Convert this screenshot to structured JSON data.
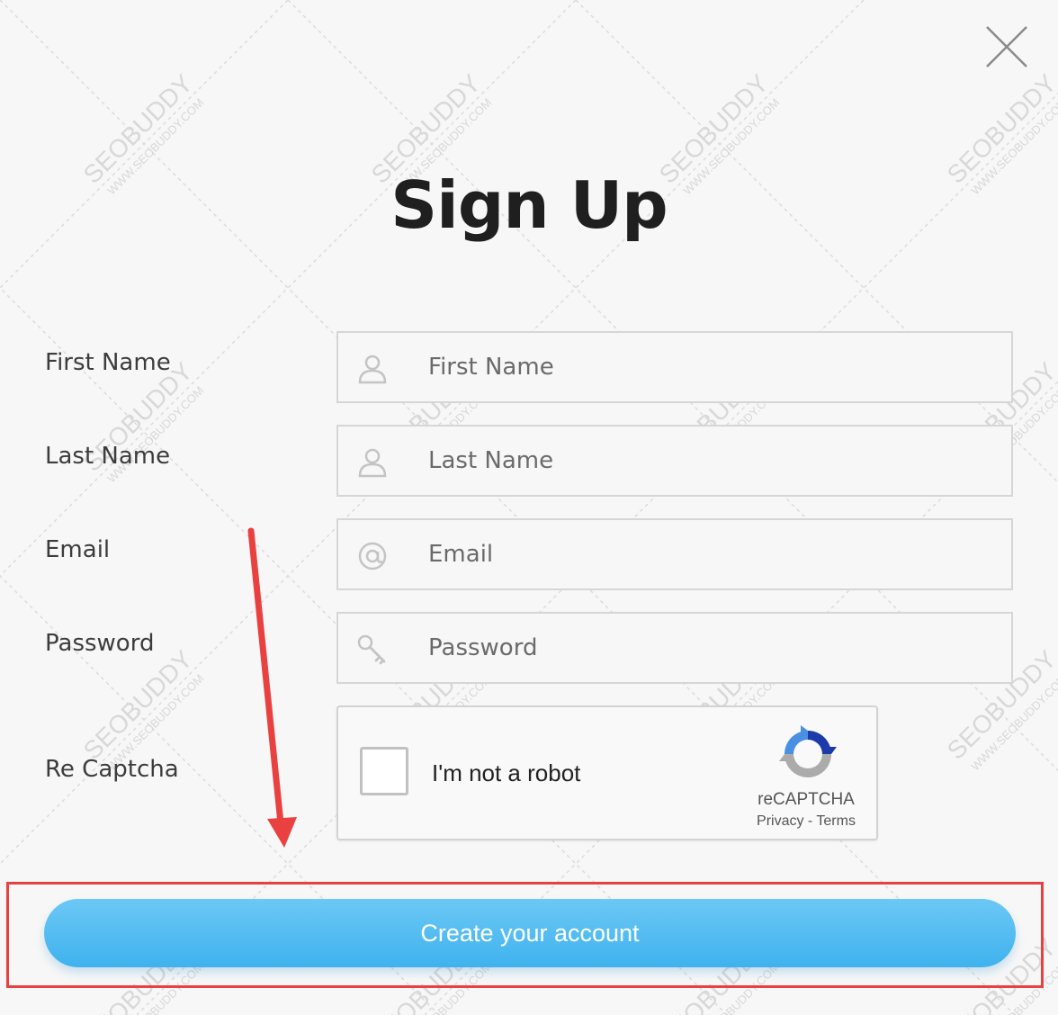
{
  "watermark": {
    "brand": "SEOBUDDY",
    "domain": "WWW.SEOBUDDY.COM"
  },
  "header": {
    "title": "Sign Up"
  },
  "form": {
    "first_name": {
      "label": "First Name",
      "placeholder": "First Name",
      "icon": "user-icon"
    },
    "last_name": {
      "label": "Last Name",
      "placeholder": "Last Name",
      "icon": "user-icon"
    },
    "email": {
      "label": "Email",
      "placeholder": "Email",
      "icon": "at-icon"
    },
    "password": {
      "label": "Password",
      "placeholder": "Password",
      "icon": "key-icon"
    },
    "captcha": {
      "label": "Re Captcha",
      "checkbox_text": "I'm not a robot",
      "brand": "reCAPTCHA",
      "privacy": "Privacy",
      "separator": "-",
      "terms": "Terms",
      "icon": "recaptcha-logo-icon"
    },
    "submit_label": "Create your account"
  },
  "close": {
    "icon": "close-icon"
  },
  "annotations": {
    "arrow_color": "#e8413f",
    "highlight_color": "#e8413f"
  },
  "colors": {
    "button": "#4db9f0",
    "background": "#f7f7f7",
    "title": "#1f1f1f"
  }
}
